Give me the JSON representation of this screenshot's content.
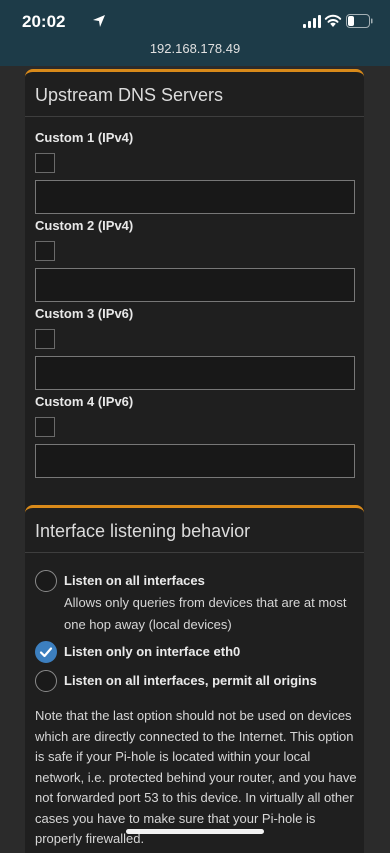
{
  "status_bar": {
    "time": "20:02",
    "url": "192.168.178.49"
  },
  "dns_card": {
    "title": "Upstream DNS Servers",
    "fields": [
      {
        "label": "Custom 1 (IPv4)",
        "checked": false,
        "value": ""
      },
      {
        "label": "Custom 2 (IPv4)",
        "checked": false,
        "value": ""
      },
      {
        "label": "Custom 3 (IPv6)",
        "checked": false,
        "value": ""
      },
      {
        "label": "Custom 4 (IPv6)",
        "checked": false,
        "value": ""
      }
    ]
  },
  "interface_card": {
    "title": "Interface listening behavior",
    "options": [
      {
        "label": "Listen on all interfaces",
        "description": "Allows only queries from devices that are at most one hop away (local devices)",
        "selected": false
      },
      {
        "label": "Listen only on interface eth0",
        "selected": true
      },
      {
        "label": "Listen on all interfaces, permit all origins",
        "selected": false
      }
    ],
    "note": "Note that the last option should not be used on devices which are directly connected to the Internet. This option is safe if your Pi-hole is located within your local network, i.e. protected behind your router, and you have not forwarded port 53 to this device. In virtually all other cases you have to make sure that your Pi-hole is properly firewalled."
  },
  "colors": {
    "accent_orange": "#d98a1a",
    "status_bar_bg": "#1d3b48",
    "radio_selected": "#3c7fbf"
  }
}
